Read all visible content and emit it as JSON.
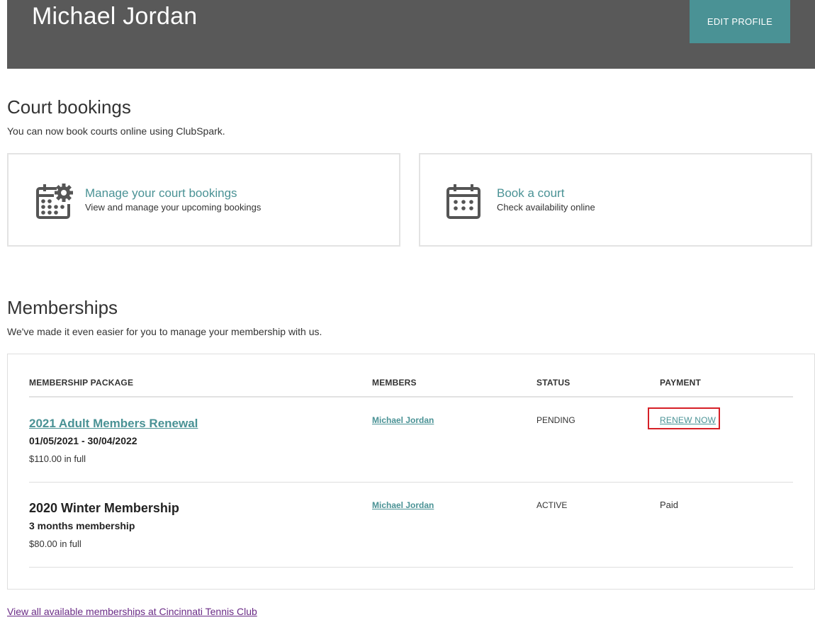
{
  "profile": {
    "name": "Michael Jordan",
    "edit_label": "EDIT PROFILE"
  },
  "court": {
    "title": "Court bookings",
    "subtitle": "You can now book courts online using ClubSpark.",
    "cards": [
      {
        "title": "Manage your court bookings",
        "subtitle": "View and manage your upcoming bookings",
        "icon": "calendar-gear-icon"
      },
      {
        "title": "Book a court",
        "subtitle": "Check availability online",
        "icon": "calendar-icon"
      }
    ]
  },
  "memberships": {
    "title": "Memberships",
    "subtitle": "We've made it even easier for you to manage your membership with us.",
    "columns": [
      "MEMBERSHIP PACKAGE",
      "MEMBERS",
      "STATUS",
      "PAYMENT"
    ],
    "rows": [
      {
        "package": "2021 Adult Members Renewal",
        "detail": "01/05/2021 - 30/04/2022",
        "price": "$110.00 in full",
        "member": "Michael Jordan",
        "status": "PENDING",
        "payment": "RENEW NOW"
      },
      {
        "package": "2020 Winter Membership",
        "detail": "3 months membership",
        "price": "$80.00 in full",
        "member": "Michael Jordan",
        "status": "ACTIVE",
        "payment": "Paid"
      }
    ],
    "footer_link": "View all available memberships at Cincinnati Tennis Club"
  },
  "colors": {
    "accent": "#4a9295",
    "header_bg": "#595959",
    "highlight": "#d62027",
    "visited_link": "#6a2b86"
  }
}
